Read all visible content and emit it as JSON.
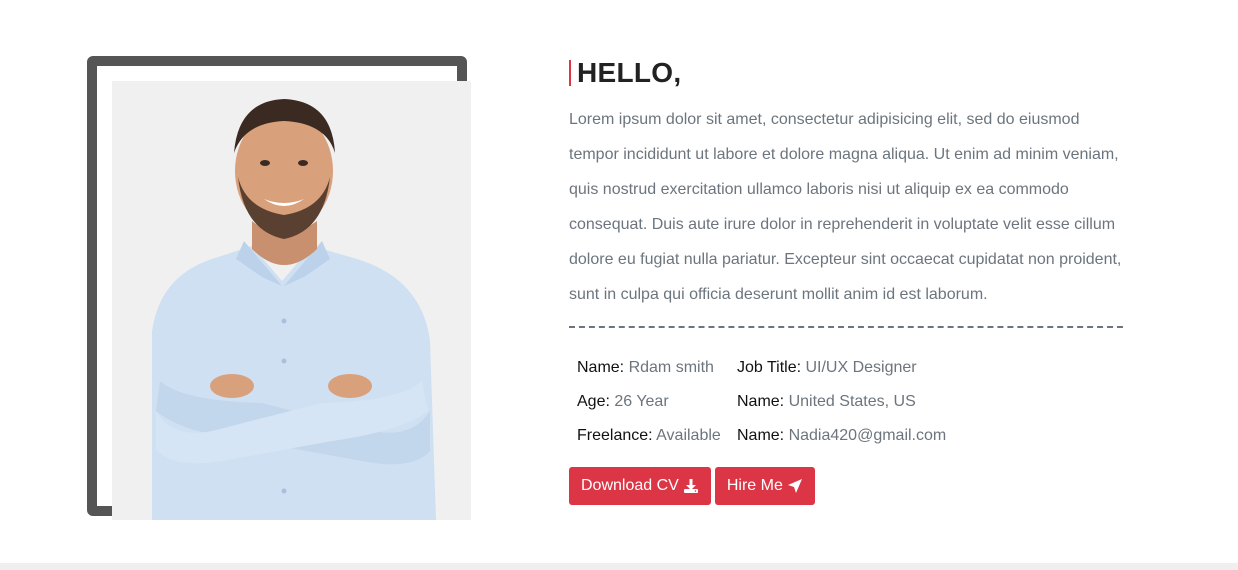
{
  "about": {
    "greeting": "HELLO,",
    "bio": "Lorem ipsum dolor sit amet, consectetur adipisicing elit, sed do eiusmod tempor incididunt ut labore et dolore magna aliqua. Ut enim ad minim veniam, quis nostrud exercitation ullamco laboris nisi ut aliquip ex ea commodo consequat. Duis aute irure dolor in reprehenderit in voluptate velit esse cillum dolore eu fugiat nulla pariatur. Excepteur sint occaecat cupidatat non proident, sunt in culpa qui officia deserunt mollit anim id est laborum.",
    "info": [
      {
        "label": "Name:",
        "value": "Rdam smith"
      },
      {
        "label": "Job Title:",
        "value": "UI/UX Designer"
      },
      {
        "label": "Age:",
        "value": "26 Year"
      },
      {
        "label": "Name:",
        "value": "United States, US"
      },
      {
        "label": "Freelance:",
        "value": "Available"
      },
      {
        "label": "Name:",
        "value": "Nadia420@gmail.com"
      }
    ],
    "buttons": {
      "download_label": "Download CV",
      "download_icon": "download-icon",
      "hire_label": "Hire Me",
      "hire_icon": "paper-plane-icon"
    }
  },
  "colors": {
    "accent": "#dc3545",
    "frame": "#555555",
    "text_muted": "#6c757d",
    "photo_bg": "#f0f0f0"
  }
}
